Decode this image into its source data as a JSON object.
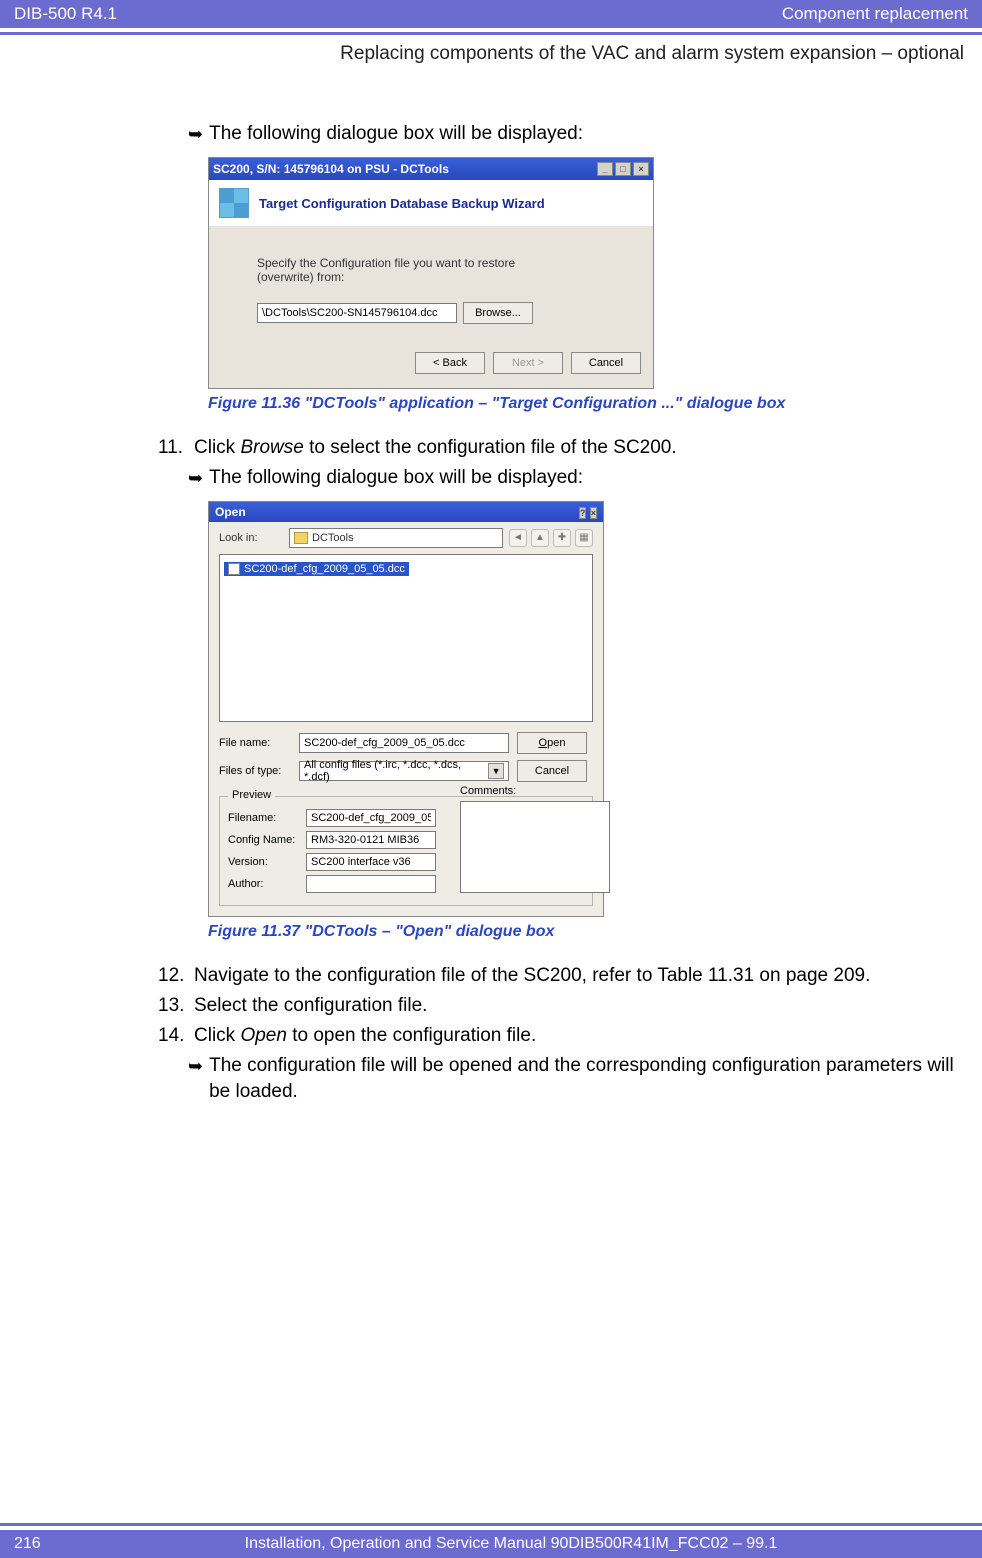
{
  "header": {
    "left": "DIB-500 R4.1",
    "right": "Component replacement"
  },
  "subheader": "Replacing components of the VAC and alarm system expansion – optional",
  "intro_arrow": "The following dialogue box will be displayed:",
  "dlg1": {
    "title": "SC200, S/N: 145796104 on PSU - DCTools",
    "band_title": "Target Configuration Database Backup Wizard",
    "prompt_line1": "Specify the Configuration file you want to restore",
    "prompt_line2": "(overwrite) from:",
    "path_value": "\\DCTools\\SC200-SN145796104.dcc",
    "browse": "Browse...",
    "back": "< Back",
    "next": "Next >",
    "cancel": "Cancel"
  },
  "fig1_caption": "Figure 11.36 \"DCTools\" application – \"Target Configuration ...\" dialogue box",
  "step11": {
    "num": "11.",
    "pre": "Click ",
    "italic": "Browse",
    "post": " to select the configuration file of the SC200."
  },
  "arrow11": "The following dialogue box will be displayed:",
  "dlg2": {
    "title": "Open",
    "lookin_label": "Look in:",
    "lookin_value": "DCTools",
    "file_item": "SC200-def_cfg_2009_05_05.dcc",
    "filename_label": "File name:",
    "filename_value": "SC200-def_cfg_2009_05_05.dcc",
    "filesoftype_label": "Files of type:",
    "filesoftype_value": "All config files (*.irc, *.dcc, *.dcs, *.dcf)",
    "open_btn": "Open",
    "cancel_btn": "Cancel",
    "preview_label": "Preview",
    "p_filename_label": "Filename:",
    "p_filename_value": "SC200-def_cfg_2009_05_",
    "p_config_label": "Config Name:",
    "p_config_value": "RM3-320-0121 MIB36",
    "p_version_label": "Version:",
    "p_version_value": "SC200 interface v36",
    "p_author_label": "Author:",
    "p_author_value": "",
    "comments_label": "Comments:"
  },
  "fig2_caption": "Figure 11.37 \"DCTools – \"Open\" dialogue box",
  "step12": {
    "num": "12.",
    "text": "Navigate to the configuration file of the SC200, refer to Table 11.31 on page 209."
  },
  "step13": {
    "num": "13.",
    "text": "Select the configuration file."
  },
  "step14": {
    "num": "14.",
    "pre": "Click ",
    "italic": "Open",
    "post": " to open the configuration file."
  },
  "arrow14": "The configuration file will be opened and the corresponding configuration parameters will be loaded.",
  "footer": {
    "page": "216",
    "text": "Installation, Operation and Service Manual 90DIB500R41IM_FCC02 – 99.1"
  }
}
